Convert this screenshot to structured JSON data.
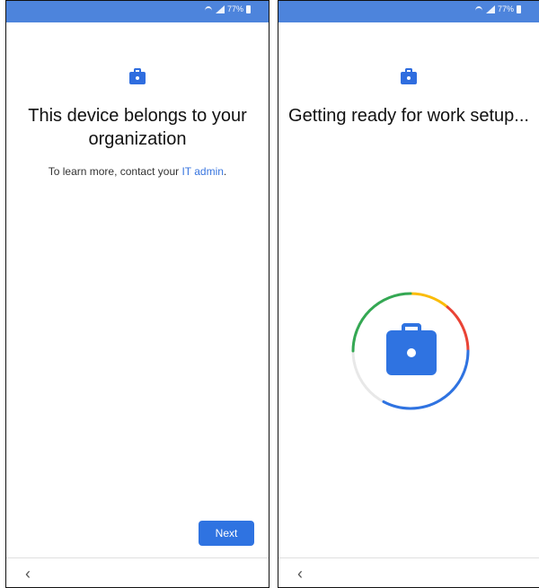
{
  "status_bar": {
    "battery_text": "77%"
  },
  "left_screen": {
    "title": "This device belongs to your organization",
    "subtitle_prefix": "To learn more, contact your ",
    "subtitle_link": "IT admin",
    "subtitle_suffix": ".",
    "next_label": "Next",
    "back_symbol": "‹"
  },
  "right_screen": {
    "title": "Getting ready for work setup...",
    "back_symbol": "‹"
  },
  "colors": {
    "status_bar": "#4d84dc",
    "accent_blue": "#2f73e1",
    "google_red": "#ea4335",
    "google_yellow": "#fbbc05",
    "google_green": "#34a853",
    "ring_gray": "#e8e8e8"
  },
  "icons": {
    "small_icon": "briefcase-icon",
    "large_icon": "briefcase-icon",
    "back_icon": "chevron-left-icon",
    "wifi_icon": "wifi-icon",
    "signal_icon": "signal-icon",
    "battery_icon": "battery-icon"
  }
}
